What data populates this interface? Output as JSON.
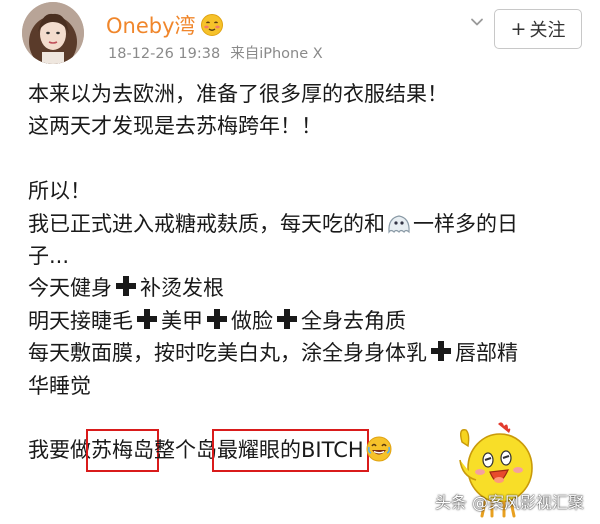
{
  "post": {
    "username": "Oneby湾",
    "timestamp": "18-12-26 19:38",
    "source": "来自iPhone X",
    "follow_label": "关注",
    "lines": {
      "l1": "本来以为去欧洲，准备了很多厚的衣服结果！",
      "l2": "这两天才发现是去苏梅跨年！！",
      "l3": "所以！",
      "l4a": "我已正式进入戒糖戒麸质，每天吃的和",
      "l4b": "一样多的日",
      "l5": "子...",
      "l6a": "今天健身",
      "l6b": "补烫发根",
      "l7a": "明天接睫毛",
      "l7b": "美甲",
      "l7c": "做脸",
      "l7d": "全身去角质",
      "l8a": "每天敷面膜，按时吃美白丸，涂全身身体乳",
      "l8b": "唇部精",
      "l9": "华睡觉",
      "l10a": "我要做",
      "l10b": "苏梅岛",
      "l10c": "整个岛",
      "l10d": "最耀眼的BITCH"
    }
  },
  "watermark": "头条 @案风影视汇聚",
  "colors": {
    "username": "#f0862b",
    "highlight_box": "#d91b1b",
    "meta": "#8a8a8a"
  },
  "icons": [
    "avatar",
    "blushing-emoji-icon",
    "chevron-down-icon",
    "ghost-emoji-icon",
    "cross-icon",
    "laughing-emoji-icon",
    "chick-sticker"
  ]
}
